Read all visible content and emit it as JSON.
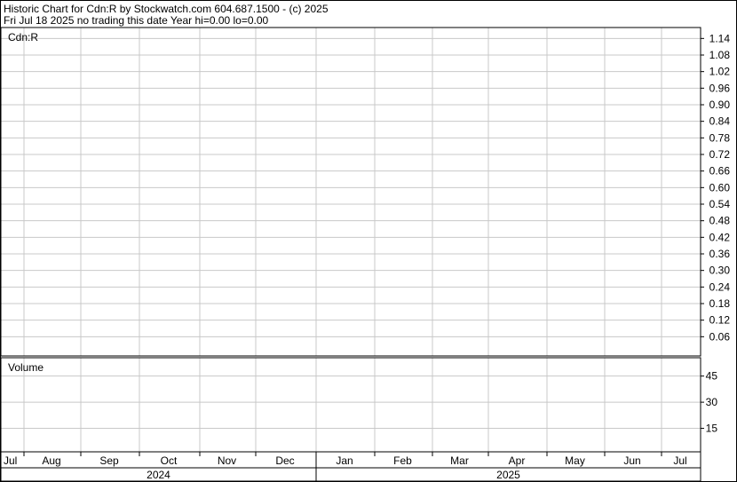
{
  "header": {
    "line1": "Historic Chart for Cdn:R by Stockwatch.com 604.687.1500 - (c) 2025",
    "line2": "Fri Jul 18 2025   no trading this date  Year hi=0.00  lo=0.00"
  },
  "chart_data": [
    {
      "type": "line",
      "title": "Cdn:R",
      "y_ticks": [
        "1.14",
        "1.08",
        "1.02",
        "0.96",
        "0.90",
        "0.84",
        "0.78",
        "0.72",
        "0.66",
        "0.60",
        "0.54",
        "0.48",
        "0.42",
        "0.36",
        "0.30",
        "0.24",
        "0.18",
        "0.12",
        "0.06"
      ],
      "ylim": [
        0.0,
        1.17
      ],
      "grid": true,
      "series": []
    },
    {
      "type": "bar",
      "title": "Volume",
      "y_ticks": [
        "45",
        "30",
        "15"
      ],
      "ylim": [
        0,
        54
      ],
      "grid": true,
      "series": []
    }
  ],
  "x_axis": {
    "months": [
      "Jul",
      "Aug",
      "Sep",
      "Oct",
      "Nov",
      "Dec",
      "Jan",
      "Feb",
      "Mar",
      "Apr",
      "May",
      "Jun",
      "Jul"
    ],
    "years": [
      "2024",
      "2025"
    ]
  },
  "colors": {
    "grid": "#c8c8c8",
    "frame": "#000000"
  }
}
